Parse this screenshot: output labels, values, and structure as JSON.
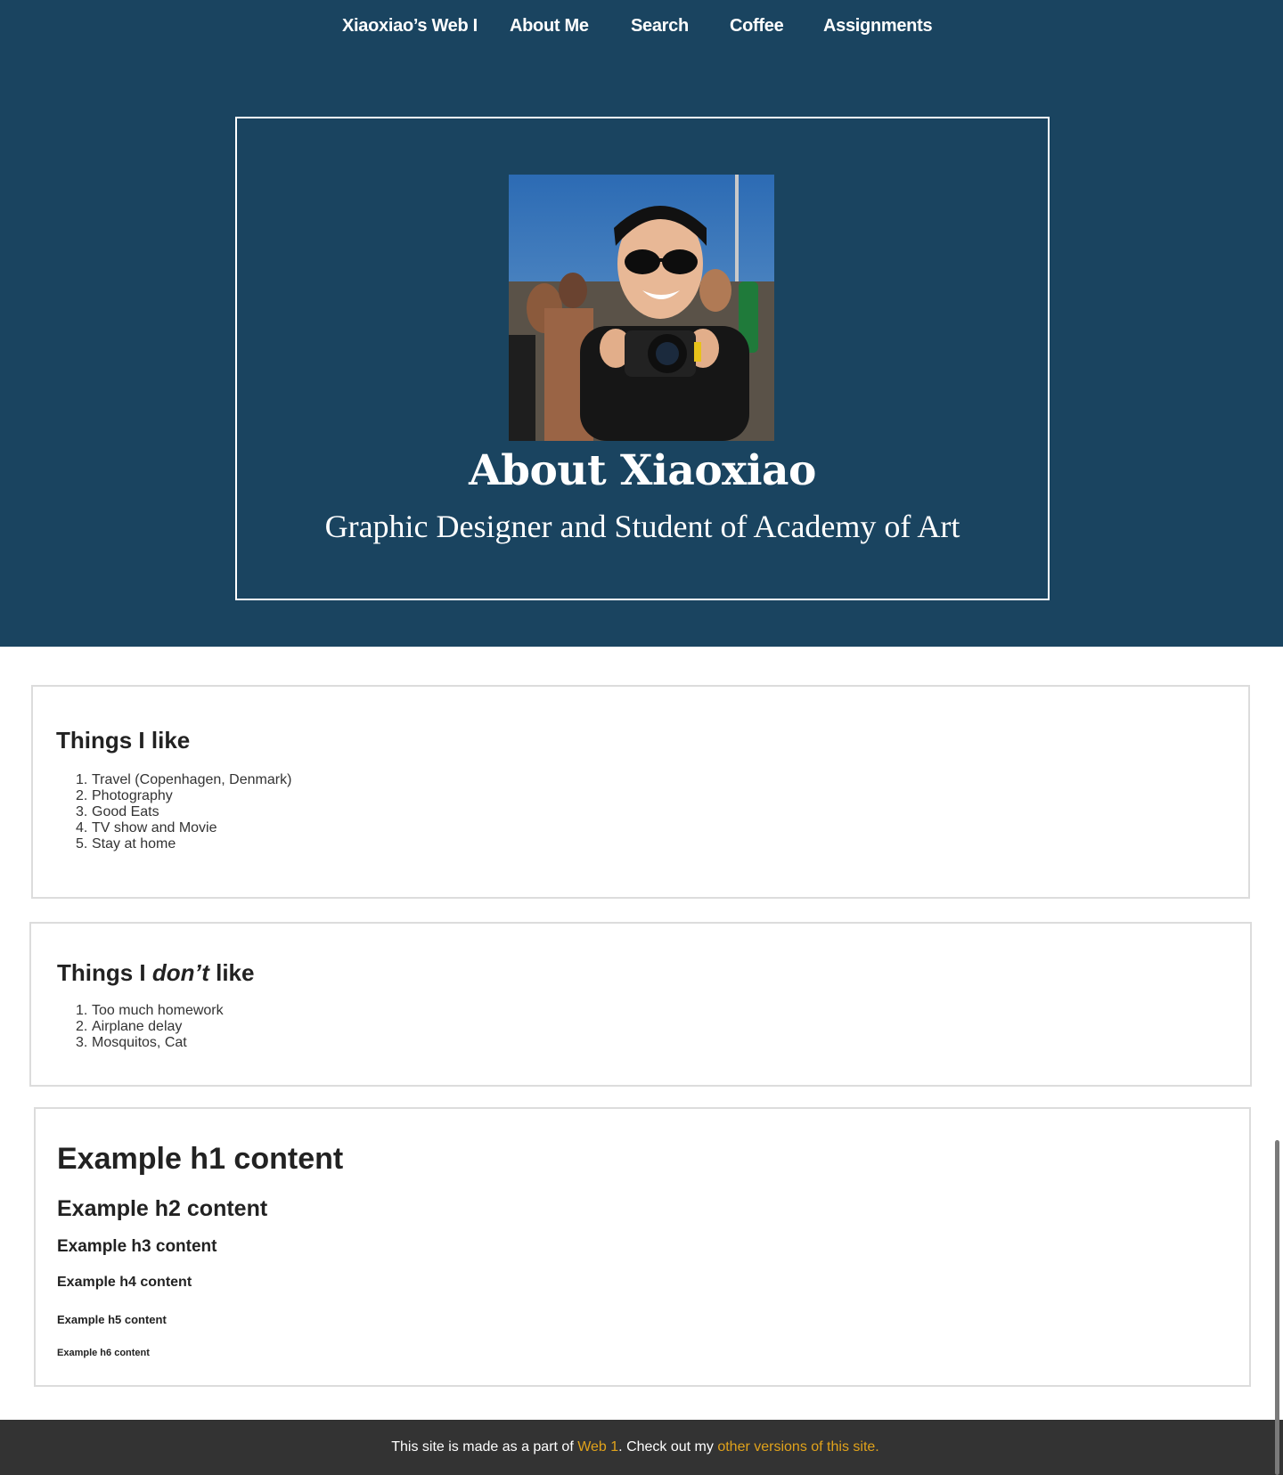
{
  "nav": {
    "items": [
      {
        "label": "Xiaoxiao’s Web I"
      },
      {
        "label": "About Me"
      },
      {
        "label": "Search"
      },
      {
        "label": "Coffee"
      },
      {
        "label": "Assignments"
      }
    ]
  },
  "hero": {
    "photo": "portrait photo of woman holding camera",
    "title": "About Xiaoxiao",
    "subtitle": "Graphic Designer and Student of Academy of Art"
  },
  "likes": {
    "heading": "Things I like",
    "items": [
      {
        "num": "1.",
        "text": "Travel (Copenhagen, Denmark)"
      },
      {
        "num": "2.",
        "text": "Photography"
      },
      {
        "num": "3.",
        "text": "Good Eats"
      },
      {
        "num": "4.",
        "text": "TV show and Movie"
      },
      {
        "num": "5.",
        "text": "Stay at home"
      }
    ]
  },
  "dislikes": {
    "heading_pre": "Things I ",
    "heading_em": "don’t",
    "heading_post": " like",
    "items": [
      {
        "num": "1.",
        "text": "Too much homework"
      },
      {
        "num": "2.",
        "text": "Airplane delay"
      },
      {
        "num": "3.",
        "text": "Mosquitos, Cat"
      }
    ]
  },
  "examples": {
    "h1": "Example h1 content",
    "h2": "Example h2 content",
    "h3": "Example h3 content",
    "h4": "Example h4 content",
    "h5": "Example h5 content",
    "h6": "Example h6 content"
  },
  "footer": {
    "text_a": "This site is made as a part of ",
    "link1": "Web 1",
    "text_b": ". Check out my ",
    "link2": "other versions of this site."
  },
  "colors": {
    "hero_bg": "#1a4460",
    "footer_bg": "#333333",
    "link": "#e0a21b"
  }
}
